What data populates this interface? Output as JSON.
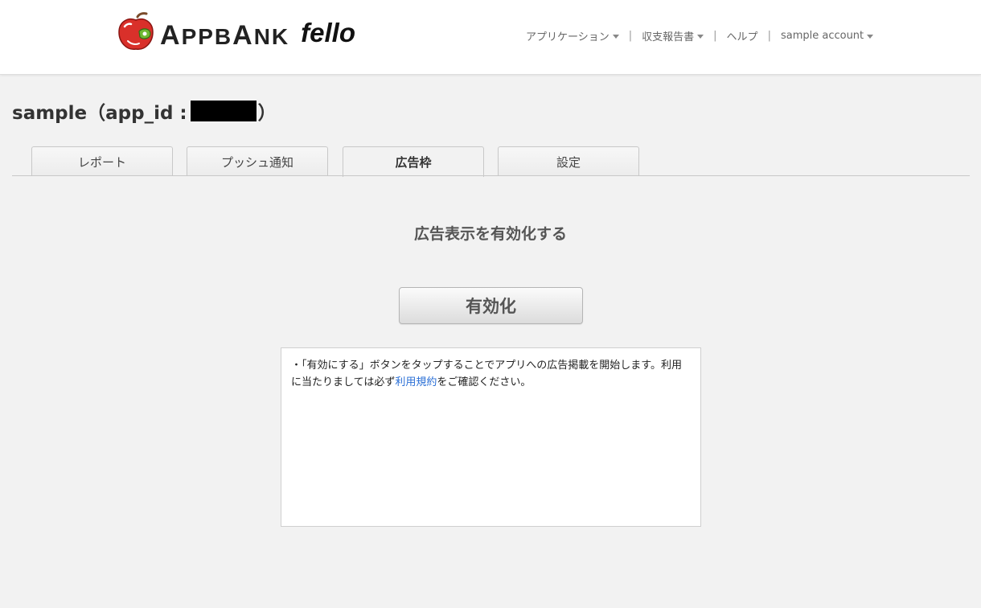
{
  "header": {
    "logo_brand_initial": "A",
    "logo_brand_rest": "PPB",
    "logo_brand_initial2": "A",
    "logo_brand_rest2": "NK",
    "logo_product": "fello"
  },
  "nav": {
    "items": [
      {
        "label": "アプリケーション",
        "dropdown": true
      },
      {
        "label": "収支報告書",
        "dropdown": true
      },
      {
        "label": "ヘルプ",
        "dropdown": false
      },
      {
        "label": "sample account",
        "dropdown": true
      }
    ],
    "separator": "|"
  },
  "page": {
    "title_prefix": "sample（app_id :",
    "title_suffix": "）"
  },
  "tabs": [
    {
      "label": "レポート",
      "active": false
    },
    {
      "label": "プッシュ通知",
      "active": false
    },
    {
      "label": "広告枠",
      "active": true
    },
    {
      "label": "設定",
      "active": false
    }
  ],
  "main": {
    "heading": "広告表示を有効化する",
    "enable_button_label": "有効化",
    "notice_text_before": "・「有効にする」ボタンをタップすることでアプリへの広告掲載を開始します。利用に当たりましては必ず",
    "notice_link": "利用規約",
    "notice_text_after": "をご確認ください。"
  },
  "colors": {
    "link": "#2a6fd6",
    "apple_red": "#d9302a",
    "background": "#f2f2f2"
  }
}
